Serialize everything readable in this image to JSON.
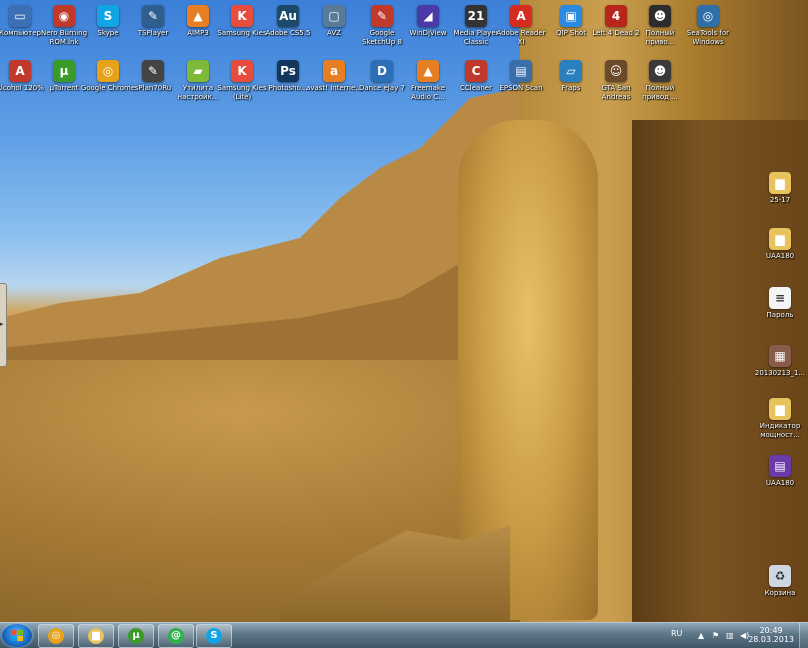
{
  "desktop": {
    "icons_row1": [
      {
        "label": "Компьютер",
        "icon": "computer-icon",
        "color": "#3b6fb6",
        "glyph": "▭"
      },
      {
        "label": "Nero Burning ROM.lnk",
        "icon": "nero-icon",
        "color": "#c0392b",
        "glyph": "◉"
      },
      {
        "label": "Skype",
        "icon": "skype-icon",
        "color": "#12a5e6",
        "glyph": "S"
      },
      {
        "label": "TSPlayer",
        "icon": "tsplayer-icon",
        "color": "#2f5f8f",
        "glyph": "✎"
      },
      {
        "label": "AIMP3",
        "icon": "aimp-icon",
        "color": "#e67e22",
        "glyph": "▲"
      },
      {
        "label": "Samsung Kies",
        "icon": "samsung-kies-icon",
        "color": "#e74c3c",
        "glyph": "K"
      },
      {
        "label": "Adobe CS5.5",
        "icon": "adobe-audition-icon",
        "color": "#1b4a6b",
        "glyph": "Au"
      },
      {
        "label": "AVZ",
        "icon": "avz-icon",
        "color": "#5a7a9a",
        "glyph": "▢"
      },
      {
        "label": "Google SketchUp 8",
        "icon": "sketchup-icon",
        "color": "#c0392b",
        "glyph": "✎"
      },
      {
        "label": "WinDjView",
        "icon": "windjview-icon",
        "color": "#4a3aa8",
        "glyph": "◢"
      },
      {
        "label": "Media Player Classic",
        "icon": "media-player-classic-icon",
        "color": "#333333",
        "glyph": "21"
      },
      {
        "label": "Adobe Reader XI",
        "icon": "adobe-reader-icon",
        "color": "#d62b1f",
        "glyph": "A"
      },
      {
        "label": "QIP Shot",
        "icon": "qip-shot-icon",
        "color": "#2a8ae0",
        "glyph": "▣"
      },
      {
        "label": "Left 4 Dead 2",
        "icon": "left4dead-icon",
        "color": "#b8261b",
        "glyph": "4"
      },
      {
        "label": "Полный приво...",
        "icon": "game-icon",
        "color": "#2c2c2c",
        "glyph": "☻"
      },
      {
        "label": "SeaTools for Windows",
        "icon": "seatools-icon",
        "color": "#2f6fa8",
        "glyph": "◎"
      }
    ],
    "icons_row2": [
      {
        "label": "Alcohol 120%",
        "icon": "alcohol-icon",
        "color": "#c0392b",
        "glyph": "A"
      },
      {
        "label": "µTorrent",
        "icon": "utorrent-icon",
        "color": "#3a9b2a",
        "glyph": "µ"
      },
      {
        "label": "Google Chrome",
        "icon": "chrome-icon",
        "color": "#e8a21a",
        "glyph": "◎"
      },
      {
        "label": "sPlan70Ru",
        "icon": "splan-icon",
        "color": "#444444",
        "glyph": "✎"
      },
      {
        "label": "Утилита настройк...",
        "icon": "utility-icon",
        "color": "#7fb93a",
        "glyph": "▰"
      },
      {
        "label": "Samsung Kies (Lite)",
        "icon": "samsung-kies-lite-icon",
        "color": "#e74c3c",
        "glyph": "K"
      },
      {
        "label": "Photosho...",
        "icon": "photoshop-icon",
        "color": "#12365e",
        "glyph": "Ps"
      },
      {
        "label": "avast! Interne...",
        "icon": "avast-icon",
        "color": "#e67e22",
        "glyph": "a"
      },
      {
        "label": "Dance eJay 7",
        "icon": "dance-ejay-icon",
        "color": "#2d6fb7",
        "glyph": "D"
      },
      {
        "label": "Freemake Audio C...",
        "icon": "freemake-icon",
        "color": "#e67e22",
        "glyph": "▲"
      },
      {
        "label": "CCleaner",
        "icon": "ccleaner-icon",
        "color": "#c0392b",
        "glyph": "C"
      },
      {
        "label": "EPSON Scan",
        "icon": "epson-scan-icon",
        "color": "#3a6ea8",
        "glyph": "▤"
      },
      {
        "label": "Fraps",
        "icon": "fraps-icon",
        "color": "#2a7fbf",
        "glyph": "▱"
      },
      {
        "label": "GTA San Andreas",
        "icon": "gta-icon",
        "color": "#6b4a2a",
        "glyph": "☺"
      },
      {
        "label": "Полный привод ...",
        "icon": "game-icon",
        "color": "#3a3a3a",
        "glyph": "☻"
      }
    ],
    "icons_right": [
      {
        "label": "25-17",
        "icon": "folder-icon",
        "color": "#e8c25a",
        "glyph": "▆"
      },
      {
        "label": "UAA180",
        "icon": "folder-icon",
        "color": "#e8c25a",
        "glyph": "▆"
      },
      {
        "label": "Пароль",
        "icon": "text-file-icon",
        "color": "#f4f4f4",
        "glyph": "≡"
      },
      {
        "label": "20130213_1...",
        "icon": "image-file-icon",
        "color": "#8a5a4a",
        "glyph": "▦"
      },
      {
        "label": "Индикатор мощност...",
        "icon": "folder-icon",
        "color": "#e8c25a",
        "glyph": "▆"
      },
      {
        "label": "UAA180",
        "icon": "archive-icon",
        "color": "#6a3aa8",
        "glyph": "▤"
      },
      {
        "label": "Корзина",
        "icon": "recycle-bin-icon",
        "color": "#cfd8e0",
        "glyph": "♻"
      }
    ]
  },
  "taskbar": {
    "pinned": [
      {
        "icon": "chrome-icon",
        "color": "#e8a21a",
        "glyph": "◎"
      },
      {
        "icon": "explorer-folder-icon",
        "color": "#e8c25a",
        "glyph": "▆"
      },
      {
        "icon": "utorrent-icon",
        "color": "#3a9b2a",
        "glyph": "µ"
      },
      {
        "icon": "mail-agent-icon",
        "color": "#2db34a",
        "glyph": "@"
      },
      {
        "icon": "skype-icon",
        "color": "#12a5e6",
        "glyph": "S"
      }
    ],
    "tray": {
      "language": "RU",
      "time": "20:49",
      "date": "28.03.2013"
    }
  }
}
